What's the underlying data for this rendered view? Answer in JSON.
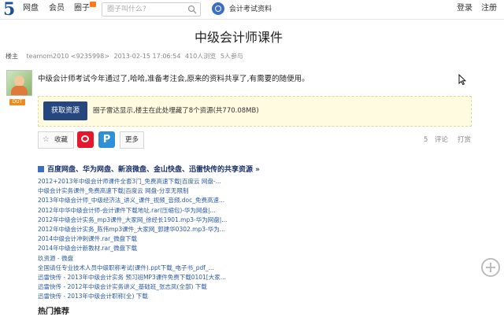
{
  "header": {
    "logo": "5",
    "nav": [
      "网盘",
      "会员",
      "圈子"
    ],
    "search_placeholder": "圈子叫什么?",
    "circle_name": "会计考试资料",
    "login": "登录",
    "register": "注册"
  },
  "post": {
    "title": "中级会计师课件",
    "owner_label": "楼主",
    "author": "teamom2010 <9235998>",
    "datetime": "2013-02-15 17:06:54",
    "views": "410人浏览",
    "participants": "5人参与",
    "badge": "DUT",
    "content": "中级会计师考试今年通过了,哈哈,准备考注会,原来的资料共享了,有需要的随便用。"
  },
  "resource": {
    "button": "获取资源",
    "text": "圈子雷达显示,楼主在此处埋藏了8个资源(共770.08MB)"
  },
  "actions": {
    "favorite": "收藏",
    "more": "更多",
    "comment_count": "5",
    "comment": "评论",
    "reward": "打赏"
  },
  "links": {
    "heading": "百度网盘、华为网盘、新浪微盘、金山快盘、迅雷快传的共享资源 »",
    "items": [
      "2012+2013年中级会计师课件全套3门_免费高速下载|百度云 网盘-...",
      "中级会计实务课件_免费高速下载|百度云 网盘-分享无限制",
      "2013年中级会计师_中级经济法_讲义_课件_视频_音频.doc_免费高速...",
      "2012年中华中级会计师-会计课件下载地址.rar(压缩包)-华为网盘|...",
      "2012年中级会计实务_mp3课件_大家网_徐经长1901.mp3-华为网盘|...",
      "2012年中级会计实务_陈伟mp3课件_大家网_郭建华0302.mp3-华为...",
      "2014中级会计冲刺课件.rar_微盘下载",
      "2014年中级会计新教材.rar_微盘下载",
      "玖资源 - 微盘",
      "全国请任专业技术人员中级职称考试(课件).ppt下载_电子书_pdf_...",
      "迅雷快传 - 2013年中级会计实务 预习班MP3课件免费下载0101[大家...",
      "迅雷快传 - 2012年中级会计实务讲义_基础班_张志凤(全部) 下载",
      "迅雷快传 - 2013年中级会计职称(全) 下载"
    ]
  },
  "hot": {
    "title": "热门推荐"
  },
  "colors": {
    "brand": "#1e4f9c",
    "button": "#25467f",
    "link": "#2b5aa8",
    "highlight_bg": "#fffbe0",
    "badge": "#f08a1c"
  }
}
